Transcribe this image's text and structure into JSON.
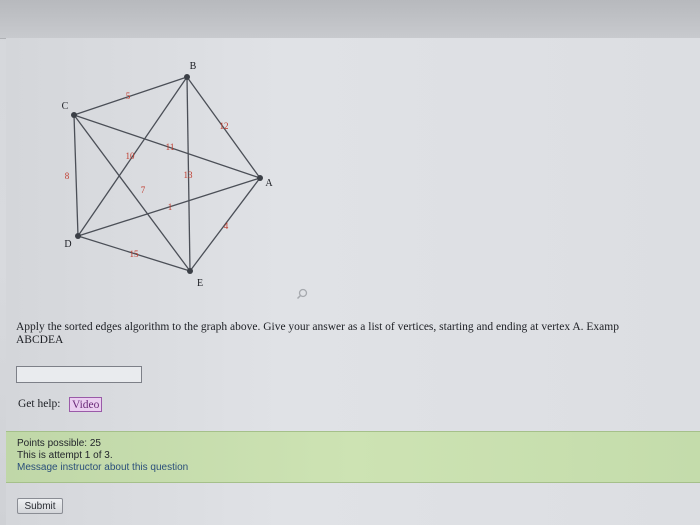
{
  "graph": {
    "vertices": [
      {
        "id": "A",
        "label": "A"
      },
      {
        "id": "B",
        "label": "B"
      },
      {
        "id": "C",
        "label": "C"
      },
      {
        "id": "D",
        "label": "D"
      },
      {
        "id": "E",
        "label": "E"
      }
    ],
    "edges": [
      {
        "from": "C",
        "to": "B",
        "weight": "5"
      },
      {
        "from": "B",
        "to": "A",
        "weight": "12"
      },
      {
        "from": "C",
        "to": "A",
        "weight": "11"
      },
      {
        "from": "B",
        "to": "E",
        "weight": "13"
      },
      {
        "from": "C",
        "to": "E",
        "weight": "10"
      },
      {
        "from": "C",
        "to": "D",
        "weight": "8"
      },
      {
        "from": "B",
        "to": "D",
        "weight": "7"
      },
      {
        "from": "D",
        "to": "A",
        "weight": "1"
      },
      {
        "from": "E",
        "to": "A",
        "weight": "4"
      },
      {
        "from": "D",
        "to": "E",
        "weight": "15"
      }
    ]
  },
  "question": {
    "text": "Apply the sorted edges algorithm to the graph above. Give your answer as a list of vertices, starting and ending at vertex A. Examp",
    "example_answer": "ABCDEA"
  },
  "answer": {
    "value": "",
    "placeholder": ""
  },
  "help": {
    "label": "Get help:",
    "video_label": "Video"
  },
  "info": {
    "points": "Points possible: 25",
    "attempt": "This is attempt 1 of 3.",
    "message_link": "Message instructor about this question"
  },
  "submit_label": "Submit",
  "icons": {
    "zoom": "magnifier-icon"
  }
}
